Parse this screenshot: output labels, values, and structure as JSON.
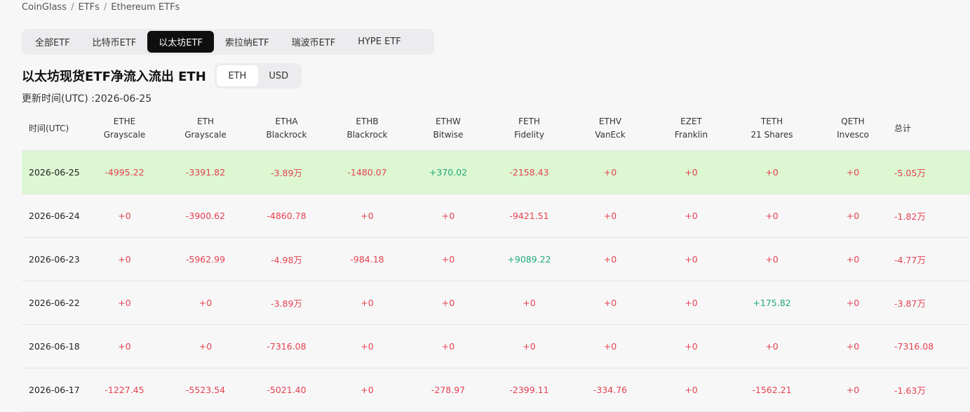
{
  "breadcrumb": [
    "CoinGlass",
    "ETFs",
    "Ethereum ETFs"
  ],
  "tabs": [
    "全部ETF",
    "比特币ETF",
    "以太坊ETF",
    "索拉纳ETF",
    "瑞波币ETF",
    "HYPE ETF"
  ],
  "active_tab": "以太坊ETF",
  "title": "以太坊现货ETF净流入流出 ETH",
  "unit_toggle": {
    "options": [
      "ETH",
      "USD"
    ],
    "selected": "ETH"
  },
  "updated": "更新时间(UTC) :2026-06-25",
  "table": {
    "date_header": "时间(UTC)",
    "total_header": "总计",
    "columns": [
      {
        "ticker": "ETHE",
        "issuer": "Grayscale"
      },
      {
        "ticker": "ETH",
        "issuer": "Grayscale"
      },
      {
        "ticker": "ETHA",
        "issuer": "Blackrock"
      },
      {
        "ticker": "ETHB",
        "issuer": "Blackrock"
      },
      {
        "ticker": "ETHW",
        "issuer": "Bitwise"
      },
      {
        "ticker": "FETH",
        "issuer": "Fidelity"
      },
      {
        "ticker": "ETHV",
        "issuer": "VanEck"
      },
      {
        "ticker": "EZET",
        "issuer": "Franklin"
      },
      {
        "ticker": "TETH",
        "issuer": "21 Shares"
      },
      {
        "ticker": "QETH",
        "issuer": "Invesco"
      }
    ],
    "rows": [
      {
        "date": "2026-06-25",
        "values": [
          "-4995.22",
          "-3391.82",
          "-3.89万",
          "-1480.07",
          "+370.02",
          "-2158.43",
          "+0",
          "+0",
          "+0",
          "+0"
        ],
        "total": "-5.05万"
      },
      {
        "date": "2026-06-24",
        "values": [
          "+0",
          "-3900.62",
          "-4860.78",
          "+0",
          "+0",
          "-9421.51",
          "+0",
          "+0",
          "+0",
          "+0"
        ],
        "total": "-1.82万"
      },
      {
        "date": "2026-06-23",
        "values": [
          "+0",
          "-5962.99",
          "-4.98万",
          "-984.18",
          "+0",
          "+9089.22",
          "+0",
          "+0",
          "+0",
          "+0"
        ],
        "total": "-4.77万"
      },
      {
        "date": "2026-06-22",
        "values": [
          "+0",
          "+0",
          "-3.89万",
          "+0",
          "+0",
          "+0",
          "+0",
          "+0",
          "+175.82",
          "+0"
        ],
        "total": "-3.87万"
      },
      {
        "date": "2026-06-18",
        "values": [
          "+0",
          "+0",
          "-7316.08",
          "+0",
          "+0",
          "+0",
          "+0",
          "+0",
          "+0",
          "+0"
        ],
        "total": "-7316.08"
      },
      {
        "date": "2026-06-17",
        "values": [
          "-1227.45",
          "-5523.54",
          "-5021.40",
          "+0",
          "-278.97",
          "-2399.11",
          "-334.76",
          "+0",
          "-1562.21",
          "+0"
        ],
        "total": "-1.63万"
      }
    ]
  },
  "colors": {
    "negative": "#e5414f",
    "positive": "#1fa978",
    "highlight_row": "#dcf7d2"
  }
}
